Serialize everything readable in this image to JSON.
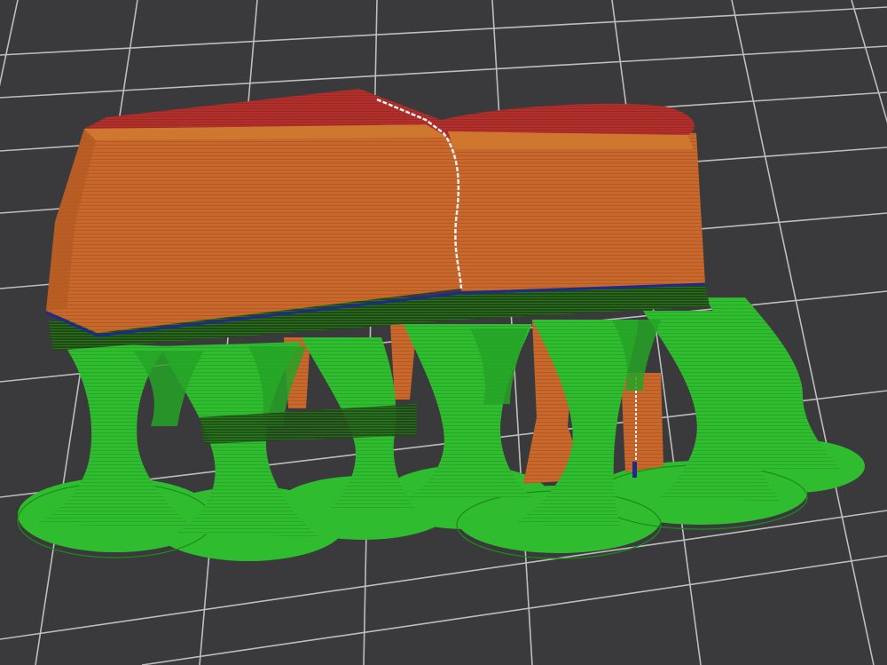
{
  "viewport": {
    "view_mode": "3d-preview",
    "background_color": "#3a3a3c",
    "grid_color": "#bdbdbd",
    "grid_visible": true
  },
  "model": {
    "layers": {
      "outer_wall_color": "#c8682c",
      "top_surface_color": "#b2302c",
      "seam_color": "#f2f2f2",
      "interface_line_color": "#1e2a8c"
    },
    "supports": {
      "style": "tree",
      "color": "#2fbd2f",
      "shadow_color": "#1f7a1f",
      "interface_color": "#1e4a14"
    }
  }
}
